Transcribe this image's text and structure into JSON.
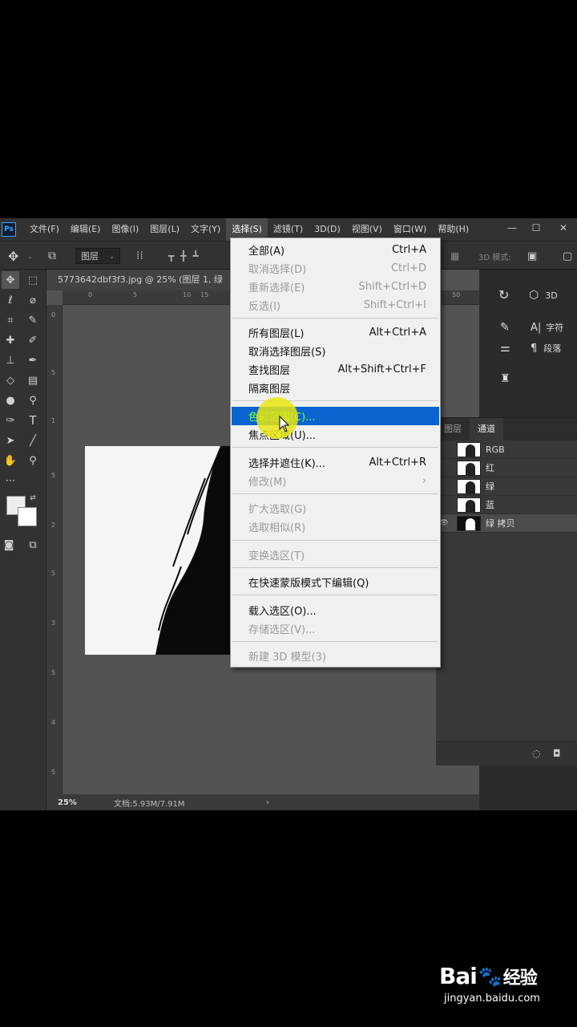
{
  "app": {
    "logo": "Ps",
    "menu": [
      "文件(F)",
      "编辑(E)",
      "图像(I)",
      "图层(L)",
      "文字(Y)",
      "选择(S)",
      "滤镜(T)",
      "3D(D)",
      "视图(V)",
      "窗口(W)",
      "帮助(H)"
    ],
    "active_menu_index": 5,
    "window_controls": [
      "—",
      "☐",
      "✕"
    ]
  },
  "options_bar": {
    "layer_select": "图层",
    "mode_label": "3D 模式:"
  },
  "document": {
    "tab_title": "5773642dbf3f3.jpg @ 25% (图层 1, 绿",
    "ruler_top": [
      "0",
      "5",
      "10",
      "15",
      "50"
    ],
    "ruler_left": [
      "0",
      "5",
      "1",
      "5",
      "2",
      "5",
      "3",
      "5",
      "4",
      "5"
    ],
    "zoom": "25%",
    "doc_info": "文档:5.93M/7.91M",
    "status_arrow": "›"
  },
  "right_panel": {
    "btn_3d": "3D",
    "btn_char": "字符",
    "btn_para": "段落"
  },
  "channels_panel": {
    "tabs": [
      "图层",
      "通道"
    ],
    "active_tab": 1,
    "rows": [
      {
        "name": "RGB",
        "visible": false,
        "selected": false
      },
      {
        "name": "红",
        "visible": false,
        "selected": false
      },
      {
        "name": "绿",
        "visible": false,
        "selected": false
      },
      {
        "name": "蓝",
        "visible": false,
        "selected": false
      },
      {
        "name": "绿 拷贝",
        "visible": true,
        "selected": true
      }
    ]
  },
  "select_menu": {
    "items": [
      {
        "label": "全部(A)",
        "shortcut": "Ctrl+A",
        "disabled": false
      },
      {
        "label": "取消选择(D)",
        "shortcut": "Ctrl+D",
        "disabled": true
      },
      {
        "label": "重新选择(E)",
        "shortcut": "Shift+Ctrl+D",
        "disabled": true
      },
      {
        "label": "反选(I)",
        "shortcut": "Shift+Ctrl+I",
        "disabled": true
      },
      {
        "label": "所有图层(L)",
        "shortcut": "Alt+Ctrl+A",
        "disabled": false
      },
      {
        "label": "取消选择图层(S)",
        "shortcut": "",
        "disabled": false
      },
      {
        "label": "查找图层",
        "shortcut": "Alt+Shift+Ctrl+F",
        "disabled": false
      },
      {
        "label": "隔离图层",
        "shortcut": "",
        "disabled": false
      },
      {
        "label": "色彩范围(C)...",
        "shortcut": "",
        "disabled": false,
        "highlight": true
      },
      {
        "label": "焦点区域(U)...",
        "shortcut": "",
        "disabled": false
      },
      {
        "label": "选择并遮住(K)...",
        "shortcut": "Alt+Ctrl+R",
        "disabled": false
      },
      {
        "label": "修改(M)",
        "shortcut": "›",
        "disabled": true
      },
      {
        "label": "扩大选取(G)",
        "shortcut": "",
        "disabled": true
      },
      {
        "label": "选取相似(R)",
        "shortcut": "",
        "disabled": true
      },
      {
        "label": "变换选区(T)",
        "shortcut": "",
        "disabled": true
      },
      {
        "label": "在快速蒙版模式下编辑(Q)",
        "shortcut": "",
        "disabled": false
      },
      {
        "label": "载入选区(O)...",
        "shortcut": "",
        "disabled": false
      },
      {
        "label": "存储选区(V)...",
        "shortcut": "",
        "disabled": true
      },
      {
        "label": "新建 3D 模型(3)",
        "shortcut": "",
        "disabled": true
      }
    ]
  },
  "watermark": {
    "brand": "Bai",
    "brand_cn": "经验",
    "url": "jingyan.baidu.com"
  }
}
